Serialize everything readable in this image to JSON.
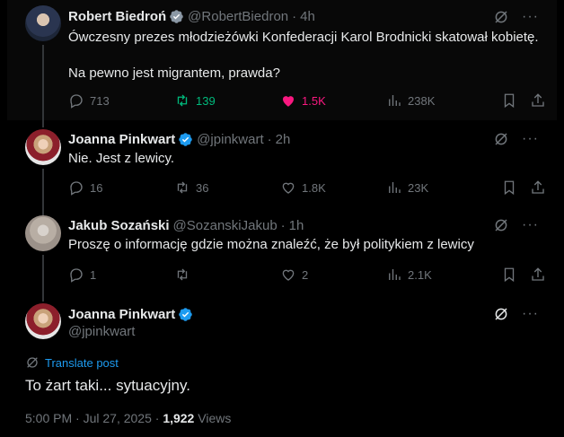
{
  "colors": {
    "accent": "#1d9bf0",
    "retweet": "#00ba7c",
    "like": "#f91880",
    "muted": "#71767b"
  },
  "tweets": [
    {
      "name": "Robert Biedroń",
      "handle": "@RobertBiedron",
      "time": "4h",
      "text_line1": "Ówczesny prezes młodzieżówki Konfederacji Karol Brodnicki skatował kobietę.",
      "text_line2": "Na pewno jest migrantem, prawda?",
      "replies": "713",
      "retweets": "139",
      "likes": "1.5K",
      "views": "238K"
    },
    {
      "name": "Joanna Pinkwart",
      "handle": "@jpinkwart",
      "time": "2h",
      "text": "Nie. Jest z lewicy.",
      "replies": "16",
      "retweets": "36",
      "likes": "1.8K",
      "views": "23K"
    },
    {
      "name": "Jakub Sozański",
      "handle": "@SozanskiJakub",
      "time": "1h",
      "text": "Proszę o informację gdzie można znaleźć, że był politykiem z lewicy",
      "replies": "1",
      "retweets": "",
      "likes": "2",
      "views": "2.1K"
    }
  ],
  "main_tweet": {
    "name": "Joanna Pinkwart",
    "handle": "@jpinkwart",
    "translate_label": "Translate post",
    "text": "To żart taki... sytuacyjny.",
    "timestamp": "5:00 PM · Jul 27, 2025 · ",
    "views_count": "1,922",
    "views_label": " Views"
  },
  "dot": "·",
  "more": "···"
}
